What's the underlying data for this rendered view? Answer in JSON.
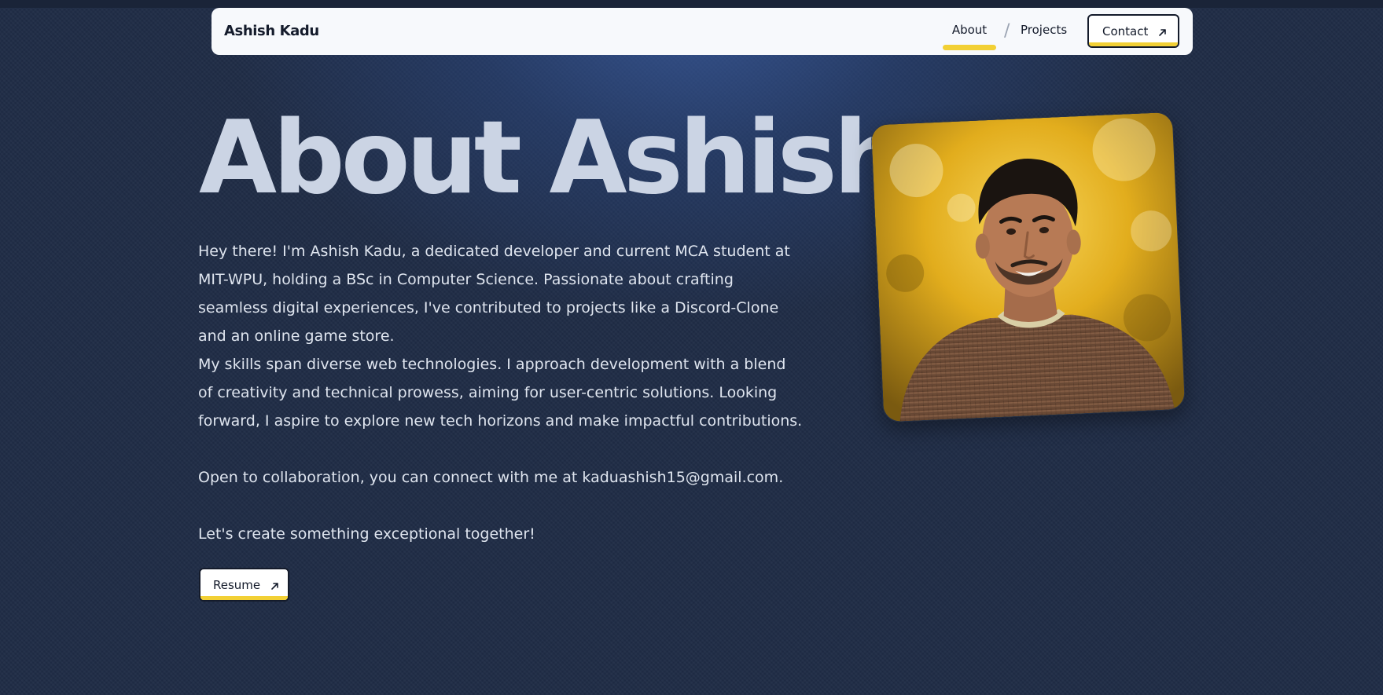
{
  "header": {
    "brand": "Ashish Kadu",
    "nav": {
      "about": "About",
      "separator": "/",
      "projects": "Projects",
      "contact": "Contact"
    }
  },
  "main": {
    "title": "About Ashish",
    "paragraphs": [
      "Hey there! I'm Ashish Kadu, a dedicated developer and current MCA student at MIT-WPU, holding a BSc in Computer Science. Passionate about crafting seamless digital experiences, I've contributed to projects like a Discord-Clone and an online game store.",
      "My skills span diverse web technologies. I approach development with a blend of creativity and technical prowess, aiming for user-centric solutions. Looking forward, I aspire to explore new tech horizons and make impactful contributions.",
      "Open to collaboration, you can connect with me at kaduashish15@gmail.com.",
      "Let's create something exceptional together!"
    ],
    "resume_label": "Resume"
  },
  "icons": {
    "arrow": "arrow-up-right-icon"
  },
  "colors": {
    "accent": "#f2d035",
    "background": "#1f2c45",
    "nav_bg": "#f7f9fc",
    "text_dark": "#141b2b",
    "title_color": "#cbd4e4"
  }
}
